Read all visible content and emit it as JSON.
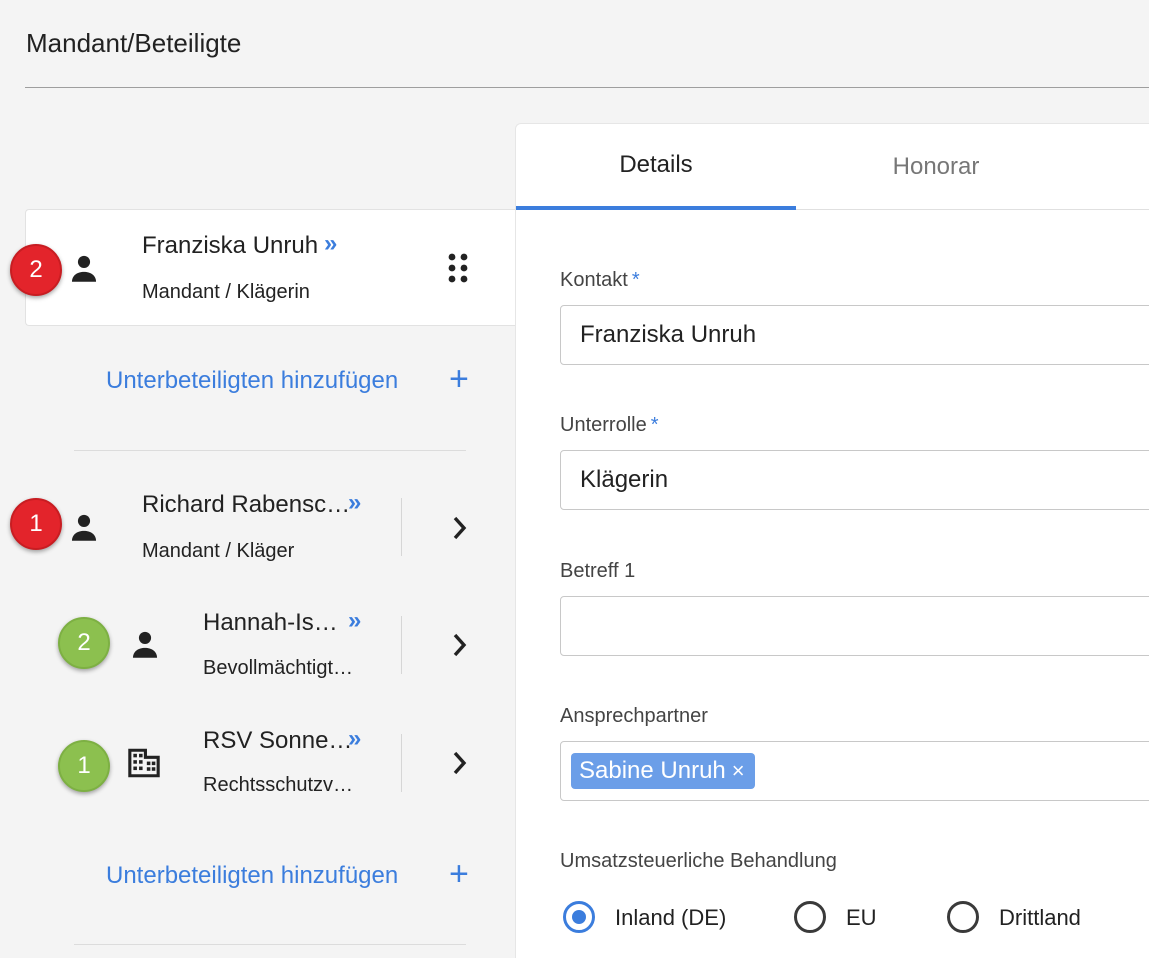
{
  "page": {
    "title": "Mandant/Beteiligte"
  },
  "participants": {
    "selected": {
      "badge": "2",
      "name": "Franziska Unruh",
      "link_glyph": "»",
      "role": "Mandant / Klägerin"
    },
    "add_sub_label": "Unterbeteiligten hinzufügen",
    "items": [
      {
        "badge": "1",
        "name": "Richard Rabensc…",
        "link_glyph": "»",
        "role": "Mandant / Kläger",
        "icon": "person-icon"
      },
      {
        "badge": "2",
        "name": "Hannah-Is…",
        "link_glyph": "»",
        "role": "Bevollmächtigt…",
        "icon": "person-icon"
      },
      {
        "badge": "1",
        "name": "RSV Sonne…",
        "link_glyph": "»",
        "role": "Rechtsschutzv…",
        "icon": "building-icon"
      }
    ]
  },
  "tabs": [
    {
      "label": "Details",
      "active": true
    },
    {
      "label": "Honorar",
      "active": false
    }
  ],
  "form": {
    "kontakt": {
      "label": "Kontakt",
      "required_mark": "*",
      "value": "Franziska Unruh"
    },
    "unterrolle": {
      "label": "Unterrolle",
      "required_mark": "*",
      "value": "Klägerin"
    },
    "betreff1": {
      "label": "Betreff 1",
      "value": ""
    },
    "ansprechpartner": {
      "label": "Ansprechpartner",
      "chips": [
        "Sabine Unruh"
      ],
      "chip_remove": "×"
    },
    "ust": {
      "label": "Umsatzsteuerliche Behandlung",
      "options": [
        "Inland (DE)",
        "EU",
        "Drittland"
      ],
      "selected": "Inland (DE)"
    }
  },
  "colors": {
    "accent": "#3b7ddd",
    "badge_red": "#e3242b",
    "badge_green": "#8cc04f",
    "chip": "#6b9ee8"
  }
}
